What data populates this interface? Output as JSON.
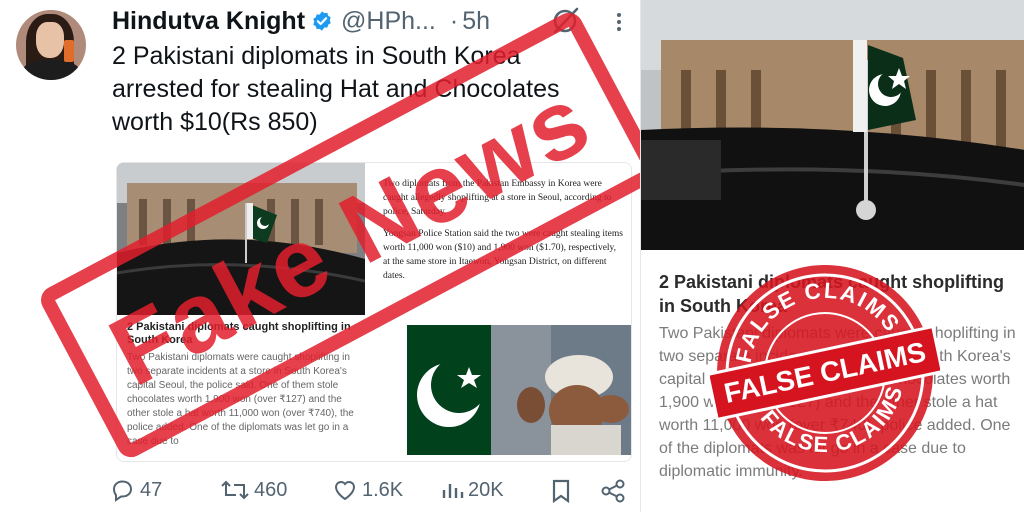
{
  "tweet": {
    "display_name": "Hindutva Knight",
    "handle": "@HPh...",
    "separator": "·",
    "time": "5h",
    "text_lines": [
      "2 Pakistani diplomats in South Korea",
      "arrested for stealing Hat and Chocolates",
      "worth $10(Rs 850)"
    ],
    "icons": [
      "verified-badge-icon",
      "grok-icon",
      "more-options-icon"
    ]
  },
  "media": {
    "card_title": "2 Pakistani diplomats caught shoplifting in South Korea",
    "card_body": "Two Pakistani diplomats were caught shoplifting in two separate incidents at a store in South Korea's capital Seoul, the police said. One of them stole chocolates worth 1,900 won (over ₹127) and the other stole a hat worth 11,000 won (over ₹740), the police added. One of the diplomats was let go in a case due to",
    "article_p1": "Two diplomats from the Pakistan Embassy in Korea were caught allegedly shoplifting at a store in Seoul, according to police, Saturday.",
    "article_p2": "Yongsan Police Station said the two were caught stealing items worth 11,000 won ($10) and 1,900 won ($1.70), respectively, at the same store in Itaewon, Yongsan District, on different dates."
  },
  "actions": {
    "replies": "47",
    "reposts": "460",
    "likes": "1.6K",
    "views": "20K"
  },
  "stamps": {
    "left": "Fake News",
    "right_main": "FALSE CLAIMS",
    "right_ring_top": "FALSE CLAIMS",
    "right_ring_bottom": "FALSE CLAIMS"
  },
  "article": {
    "title": "2 Pakistani diplomats caught shoplifting in South Korea",
    "body": "Two Pakistani diplomats were caught shoplifting in two separate incidents at a store in South Korea's capital Seoul. One of them stole chocolates worth 1,900 won (over ₹127) and the other stole a hat worth 11,000 won (over ₹740), police added. One of the diplomats was let go in a case due to diplomatic immunity."
  },
  "colors": {
    "stamp_red": "#e21e2d",
    "pak_green": "#01411c",
    "verified_blue": "#1d9bf0"
  }
}
